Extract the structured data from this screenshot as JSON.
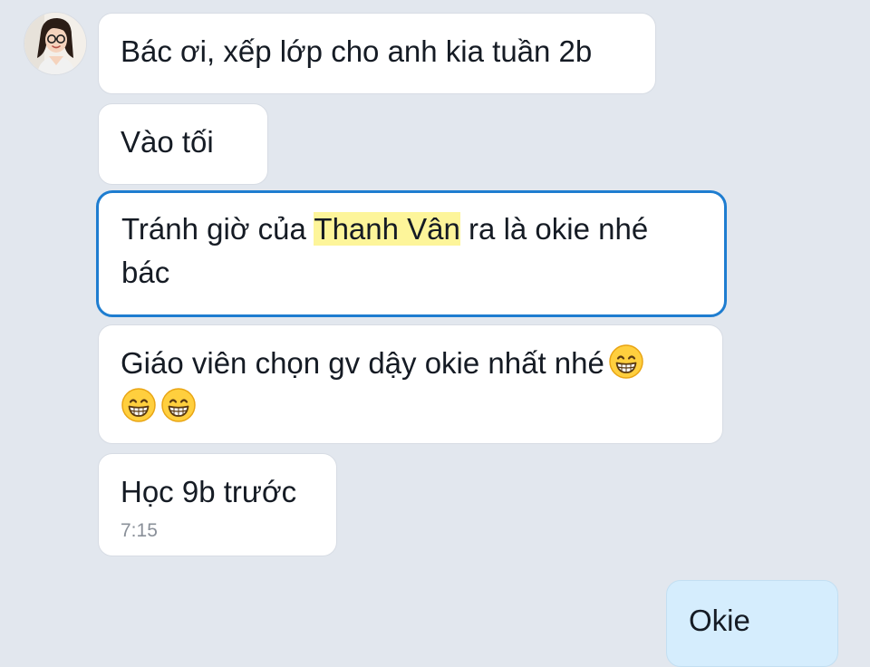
{
  "contact": {
    "avatar_icon": "woman-with-glasses-avatar-icon"
  },
  "messages": [
    {
      "text": "Bác ơi, xếp lớp cho anh kia tuần 2b"
    },
    {
      "text": "Vào tối"
    },
    {
      "text_before": "Tránh giờ của ",
      "highlight": "Thanh Vân",
      "text_after": " ra là okie nhé bác",
      "highlight_color": "#fdf59a",
      "border_color": "#1e7dd0"
    },
    {
      "text": "Giáo viên chọn gv dậy okie nhất nhé",
      "emoji_icon": "grinning-face-with-smiling-eyes-icon",
      "emoji_count": 3
    },
    {
      "text": "Học 9b trước",
      "time": "7:15"
    },
    {
      "text": "Okie",
      "outgoing": true,
      "bubble_color": "#d5edfd"
    }
  ],
  "colors": {
    "background": "#e2e7ee",
    "incoming_bubble": "#ffffff",
    "outgoing_bubble": "#d5edfd",
    "selected_border": "#1e7dd0"
  }
}
